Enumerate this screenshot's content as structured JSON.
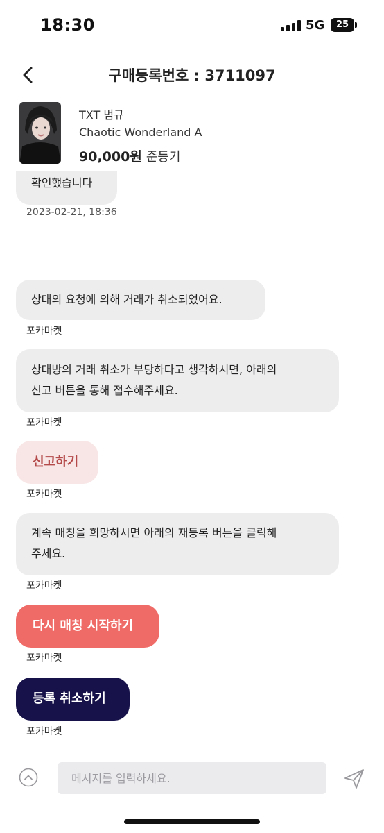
{
  "status_bar": {
    "time": "18:30",
    "network": "5G",
    "battery": "25"
  },
  "header": {
    "title": "구매등록번호 : 3711097",
    "back_icon": "chevron-left-icon"
  },
  "product": {
    "artist": "TXT 범규",
    "name": "Chaotic Wonderland A",
    "price": "90,000원",
    "condition": "준등기"
  },
  "chat": {
    "prev_message": "확인했습니다",
    "prev_timestamp": "2023-02-21, 18:36",
    "messages": [
      {
        "text": "상대의 요청에 의해 거래가 취소되었어요.",
        "sender": "포카마켓"
      },
      {
        "lines": [
          "상대방의 거래 취소가 부당하다고 생각하시면, 아래의",
          "신고 버튼을 통해 접수해주세요."
        ],
        "sender": "포카마켓"
      },
      {
        "button": "신고하기",
        "sender": "포카마켓"
      },
      {
        "lines": [
          "계속 매칭을 희망하시면 아래의 재등록 버튼을 클릭해",
          "주세요."
        ],
        "sender": "포카마켓"
      },
      {
        "button": "다시 매칭 시작하기",
        "sender": "포카마켓"
      },
      {
        "button": "등록 취소하기",
        "sender": "포카마켓"
      }
    ]
  },
  "colors": {
    "report_bg": "#f8e6e6",
    "report_text": "#b44a4a",
    "rematch_bg": "#ef6b67",
    "cancel_bg": "#17124a",
    "bubble_bg": "#ededee"
  },
  "input": {
    "placeholder": "메시지를 입력하세요.",
    "up_icon": "chevron-up-circle-icon",
    "send_icon": "send-icon"
  }
}
